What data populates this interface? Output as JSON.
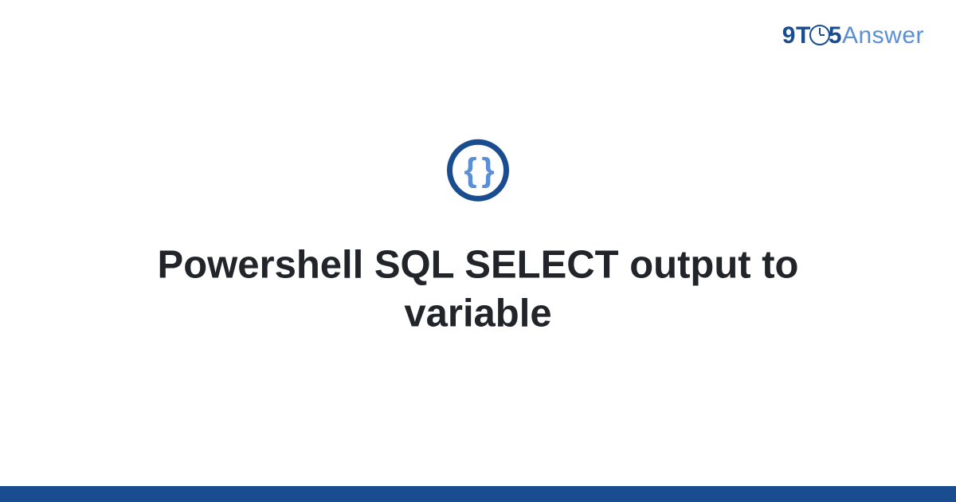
{
  "brand": {
    "nine": "9",
    "t": "T",
    "five": "5",
    "answer": "Answer"
  },
  "icon": {
    "braces": "{ }"
  },
  "title": "Powershell SQL SELECT output to variable"
}
